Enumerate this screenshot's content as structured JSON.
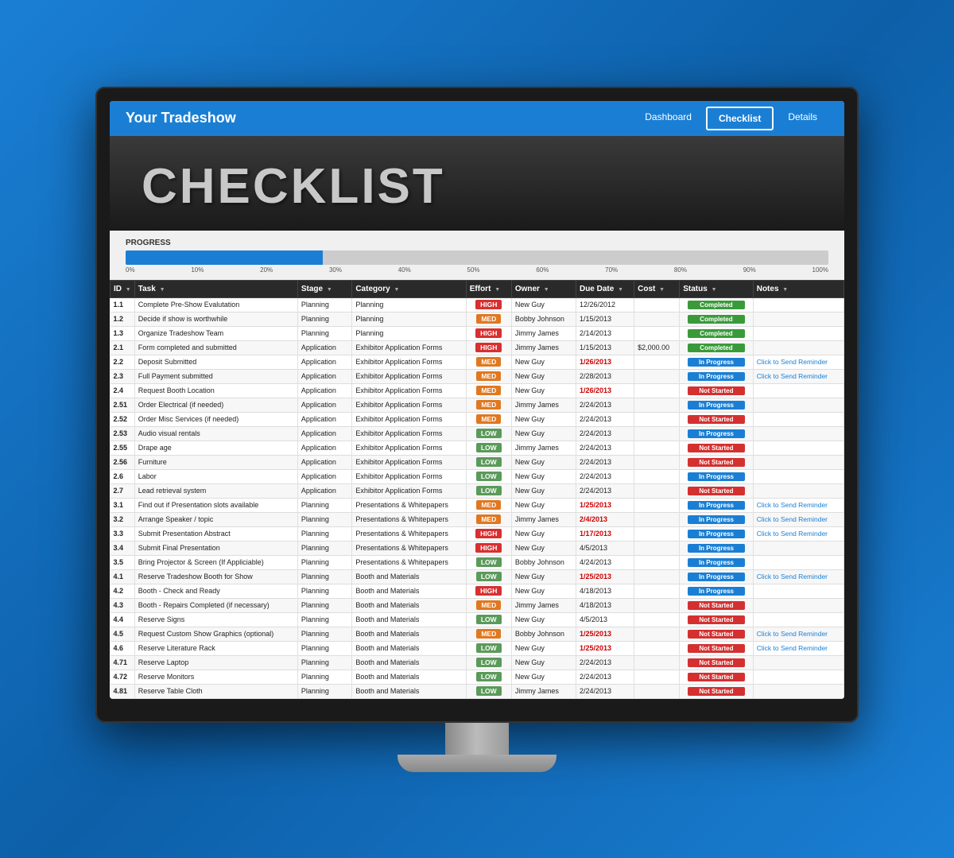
{
  "nav": {
    "title": "Your Tradeshow",
    "links": [
      {
        "label": "Dashboard",
        "active": false
      },
      {
        "label": "Checklist",
        "active": true
      },
      {
        "label": "Details",
        "active": false
      }
    ]
  },
  "header": {
    "title": "CHECKLIST"
  },
  "progress": {
    "label": "PROGRESS",
    "percent": 28,
    "ticks": [
      "0%",
      "10%",
      "20%",
      "30%",
      "40%",
      "50%",
      "60%",
      "70%",
      "80%",
      "90%",
      "100%"
    ]
  },
  "table": {
    "columns": [
      "ID",
      "Task",
      "Stage",
      "Category",
      "Effort",
      "Owner",
      "Due Date",
      "Cost",
      "Status",
      "Notes"
    ],
    "rows": [
      {
        "id": "1.1",
        "task": "Complete Pre-Show Evalutation",
        "stage": "Planning",
        "category": "Planning",
        "effort": "HIGH",
        "owner": "New Guy",
        "date": "12/26/2012",
        "cost": "",
        "status": "Completed",
        "notes": ""
      },
      {
        "id": "1.2",
        "task": "Decide if show is worthwhile",
        "stage": "Planning",
        "category": "Planning",
        "effort": "MED",
        "owner": "Bobby Johnson",
        "date": "1/15/2013",
        "cost": "",
        "status": "Completed",
        "notes": ""
      },
      {
        "id": "1.3",
        "task": "Organize Tradeshow Team",
        "stage": "Planning",
        "category": "Planning",
        "effort": "HIGH",
        "owner": "Jimmy James",
        "date": "2/14/2013",
        "cost": "",
        "status": "Completed",
        "notes": ""
      },
      {
        "id": "2.1",
        "task": "Form completed and submitted",
        "stage": "Application",
        "category": "Exhibitor Application Forms",
        "effort": "HIGH",
        "owner": "Jimmy James",
        "date": "1/15/2013",
        "cost": "$2,000.00",
        "status": "Completed",
        "notes": ""
      },
      {
        "id": "2.2",
        "task": "Deposit Submitted",
        "stage": "Application",
        "category": "Exhibitor Application Forms",
        "effort": "MED",
        "owner": "New Guy",
        "date": "1/26/2013",
        "cost": "",
        "status": "In Progress",
        "notes": "Click to Send Reminder",
        "overdue": true
      },
      {
        "id": "2.3",
        "task": "Full Payment submitted",
        "stage": "Application",
        "category": "Exhibitor Application Forms",
        "effort": "MED",
        "owner": "New Guy",
        "date": "2/28/2013",
        "cost": "",
        "status": "In Progress",
        "notes": "Click to Send Reminder"
      },
      {
        "id": "2.4",
        "task": "Request Booth Location",
        "stage": "Application",
        "category": "Exhibitor Application Forms",
        "effort": "MED",
        "owner": "New Guy",
        "date": "1/26/2013",
        "cost": "",
        "status": "Not Started",
        "notes": "",
        "overdue": true
      },
      {
        "id": "2.51",
        "task": "Order Electrical (if needed)",
        "stage": "Application",
        "category": "Exhibitor Application Forms",
        "effort": "MED",
        "owner": "Jimmy James",
        "date": "2/24/2013",
        "cost": "",
        "status": "In Progress",
        "notes": ""
      },
      {
        "id": "2.52",
        "task": "Order Misc Services (if needed)",
        "stage": "Application",
        "category": "Exhibitor Application Forms",
        "effort": "MED",
        "owner": "New Guy",
        "date": "2/24/2013",
        "cost": "",
        "status": "Not Started",
        "notes": ""
      },
      {
        "id": "2.53",
        "task": "Audio visual rentals",
        "stage": "Application",
        "category": "Exhibitor Application Forms",
        "effort": "LOW",
        "owner": "New Guy",
        "date": "2/24/2013",
        "cost": "",
        "status": "In Progress",
        "notes": ""
      },
      {
        "id": "2.55",
        "task": "Drape age",
        "stage": "Application",
        "category": "Exhibitor Application Forms",
        "effort": "LOW",
        "owner": "Jimmy James",
        "date": "2/24/2013",
        "cost": "",
        "status": "Not Started",
        "notes": ""
      },
      {
        "id": "2.56",
        "task": "Furniture",
        "stage": "Application",
        "category": "Exhibitor Application Forms",
        "effort": "LOW",
        "owner": "New Guy",
        "date": "2/24/2013",
        "cost": "",
        "status": "Not Started",
        "notes": ""
      },
      {
        "id": "2.6",
        "task": "Labor",
        "stage": "Application",
        "category": "Exhibitor Application Forms",
        "effort": "LOW",
        "owner": "New Guy",
        "date": "2/24/2013",
        "cost": "",
        "status": "In Progress",
        "notes": ""
      },
      {
        "id": "2.7",
        "task": "Lead retrieval system",
        "stage": "Application",
        "category": "Exhibitor Application Forms",
        "effort": "LOW",
        "owner": "New Guy",
        "date": "2/24/2013",
        "cost": "",
        "status": "Not Started",
        "notes": ""
      },
      {
        "id": "3.1",
        "task": "Find out if Presentation slots available",
        "stage": "Planning",
        "category": "Presentations & Whitepapers",
        "effort": "MED",
        "owner": "New Guy",
        "date": "1/25/2013",
        "cost": "",
        "status": "In Progress",
        "notes": "Click to Send Reminder",
        "overdue": true
      },
      {
        "id": "3.2",
        "task": "Arrange Speaker / topic",
        "stage": "Planning",
        "category": "Presentations & Whitepapers",
        "effort": "MED",
        "owner": "Jimmy James",
        "date": "2/4/2013",
        "cost": "",
        "status": "In Progress",
        "notes": "Click to Send Reminder",
        "overdue": true
      },
      {
        "id": "3.3",
        "task": "Submit Presentation Abstract",
        "stage": "Planning",
        "category": "Presentations & Whitepapers",
        "effort": "HIGH",
        "owner": "New Guy",
        "date": "1/17/2013",
        "cost": "",
        "status": "In Progress",
        "notes": "Click to Send Reminder",
        "overdue": true
      },
      {
        "id": "3.4",
        "task": "Submit Final Presentation",
        "stage": "Planning",
        "category": "Presentations & Whitepapers",
        "effort": "HIGH",
        "owner": "New Guy",
        "date": "4/5/2013",
        "cost": "",
        "status": "In Progress",
        "notes": ""
      },
      {
        "id": "3.5",
        "task": "Bring Projector & Screen (If Appliciable)",
        "stage": "Planning",
        "category": "Presentations & Whitepapers",
        "effort": "LOW",
        "owner": "Bobby Johnson",
        "date": "4/24/2013",
        "cost": "",
        "status": "In Progress",
        "notes": ""
      },
      {
        "id": "4.1",
        "task": "Reserve Tradeshow Booth for Show",
        "stage": "Planning",
        "category": "Booth and Materials",
        "effort": "LOW",
        "owner": "New Guy",
        "date": "1/25/2013",
        "cost": "",
        "status": "In Progress",
        "notes": "Click to Send Reminder",
        "overdue": true
      },
      {
        "id": "4.2",
        "task": "Booth - Check and Ready",
        "stage": "Planning",
        "category": "Booth and Materials",
        "effort": "HIGH",
        "owner": "New Guy",
        "date": "4/18/2013",
        "cost": "",
        "status": "In Progress",
        "notes": ""
      },
      {
        "id": "4.3",
        "task": "Booth - Repairs Completed (if necessary)",
        "stage": "Planning",
        "category": "Booth and Materials",
        "effort": "MED",
        "owner": "Jimmy James",
        "date": "4/18/2013",
        "cost": "",
        "status": "Not Started",
        "notes": ""
      },
      {
        "id": "4.4",
        "task": "Reserve Signs",
        "stage": "Planning",
        "category": "Booth and Materials",
        "effort": "LOW",
        "owner": "New Guy",
        "date": "4/5/2013",
        "cost": "",
        "status": "Not Started",
        "notes": ""
      },
      {
        "id": "4.5",
        "task": "Request Custom Show Graphics (optional)",
        "stage": "Planning",
        "category": "Booth and Materials",
        "effort": "MED",
        "owner": "Bobby Johnson",
        "date": "1/25/2013",
        "cost": "",
        "status": "Not Started",
        "notes": "Click to Send Reminder",
        "overdue": true
      },
      {
        "id": "4.6",
        "task": "Reserve Literature Rack",
        "stage": "Planning",
        "category": "Booth and Materials",
        "effort": "LOW",
        "owner": "New Guy",
        "date": "1/25/2013",
        "cost": "",
        "status": "Not Started",
        "notes": "Click to Send Reminder",
        "overdue": true
      },
      {
        "id": "4.71",
        "task": "Reserve Laptop",
        "stage": "Planning",
        "category": "Booth and Materials",
        "effort": "LOW",
        "owner": "New Guy",
        "date": "2/24/2013",
        "cost": "",
        "status": "Not Started",
        "notes": ""
      },
      {
        "id": "4.72",
        "task": "Reserve Monitors",
        "stage": "Planning",
        "category": "Booth and Materials",
        "effort": "LOW",
        "owner": "New Guy",
        "date": "2/24/2013",
        "cost": "",
        "status": "Not Started",
        "notes": ""
      },
      {
        "id": "4.81",
        "task": "Reserve Table Cloth",
        "stage": "Planning",
        "category": "Booth and Materials",
        "effort": "LOW",
        "owner": "Jimmy James",
        "date": "2/24/2013",
        "cost": "",
        "status": "Not Started",
        "notes": ""
      }
    ]
  }
}
